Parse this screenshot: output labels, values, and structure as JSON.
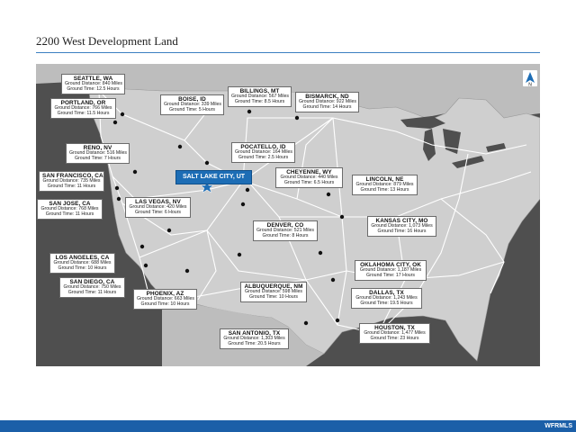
{
  "page": {
    "title": "2200 West Development Land",
    "brand": "WFRMLS"
  },
  "colors": {
    "accent": "#1d6db5",
    "land": "#c9c9c9",
    "water": "#4f4f4f",
    "road": "#ffffff",
    "footer": "#1b5fa8"
  },
  "origin": {
    "label": "SALT LAKE CITY, UT"
  },
  "compass_icon": "north-arrow-icon",
  "destinations": [
    {
      "city": "SEATTLE, WA",
      "distance": "Ground Distance: 840 Miles",
      "time": "Ground Time: 12.5 Hours"
    },
    {
      "city": "PORTLAND, OR",
      "distance": "Ground Distance: 766 Miles",
      "time": "Ground Time: 11.5 Hours"
    },
    {
      "city": "BOISE, ID",
      "distance": "Ground Distance: 339 Miles",
      "time": "Ground Time: 5 Hours"
    },
    {
      "city": "BILLINGS, MT",
      "distance": "Ground Distance: 567 Miles",
      "time": "Ground Time: 8.5 Hours"
    },
    {
      "city": "BISMARCK, ND",
      "distance": "Ground Distance: 922 Miles",
      "time": "Ground Time: 14 Hours"
    },
    {
      "city": "RENO, NV",
      "distance": "Ground Distance: 516 Miles",
      "time": "Ground Time: 7 Hours"
    },
    {
      "city": "POCATELLO, ID",
      "distance": "Ground Distance: 164 Miles",
      "time": "Ground Time: 2.5 Hours"
    },
    {
      "city": "SAN FRANCISCO, CA",
      "distance": "Ground Distance: 735 Miles",
      "time": "Ground Time: 11 Hours"
    },
    {
      "city": "CHEYENNE, WY",
      "distance": "Ground Distance: 440 Miles",
      "time": "Ground Time: 6.5 Hours"
    },
    {
      "city": "LINCOLN, NE",
      "distance": "Ground Distance: 879 Miles",
      "time": "Ground Time: 13 Hours"
    },
    {
      "city": "SAN JOSE, CA",
      "distance": "Ground Distance: 768 Miles",
      "time": "Ground Time: 11 Hours"
    },
    {
      "city": "LAS VEGAS, NV",
      "distance": "Ground Distance: 420 Miles",
      "time": "Ground Time: 6 Hours"
    },
    {
      "city": "DENVER, CO",
      "distance": "Ground Distance: 521 Miles",
      "time": "Ground Time: 8 Hours"
    },
    {
      "city": "KANSAS CITY, MO",
      "distance": "Ground Distance: 1,073 Miles",
      "time": "Ground Time: 16 Hours"
    },
    {
      "city": "LOS ANGELES, CA",
      "distance": "Ground Distance: 688 Miles",
      "time": "Ground Time: 10 Hours"
    },
    {
      "city": "OKLAHOMA CITY, OK",
      "distance": "Ground Distance: 1,187 Miles",
      "time": "Ground Time: 17 Hours"
    },
    {
      "city": "SAN DIEGO, CA",
      "distance": "Ground Distance: 750 Miles",
      "time": "Ground Time: 11 Hours"
    },
    {
      "city": "ALBUQUERQUE, NM",
      "distance": "Ground Distance: 598 Miles",
      "time": "Ground Time: 10 Hours"
    },
    {
      "city": "PHOENIX, AZ",
      "distance": "Ground Distance: 663 Miles",
      "time": "Ground Time: 10 Hours"
    },
    {
      "city": "DALLAS, TX",
      "distance": "Ground Distance: 1,243 Miles",
      "time": "Ground Time: 19.5 Hours"
    },
    {
      "city": "SAN ANTONIO, TX",
      "distance": "Ground Distance: 1,303 Miles",
      "time": "Ground Time: 20.5 Hours"
    },
    {
      "city": "HOUSTON, TX",
      "distance": "Ground Distance: 1,477 Miles",
      "time": "Ground Time: 23 Hours"
    }
  ]
}
